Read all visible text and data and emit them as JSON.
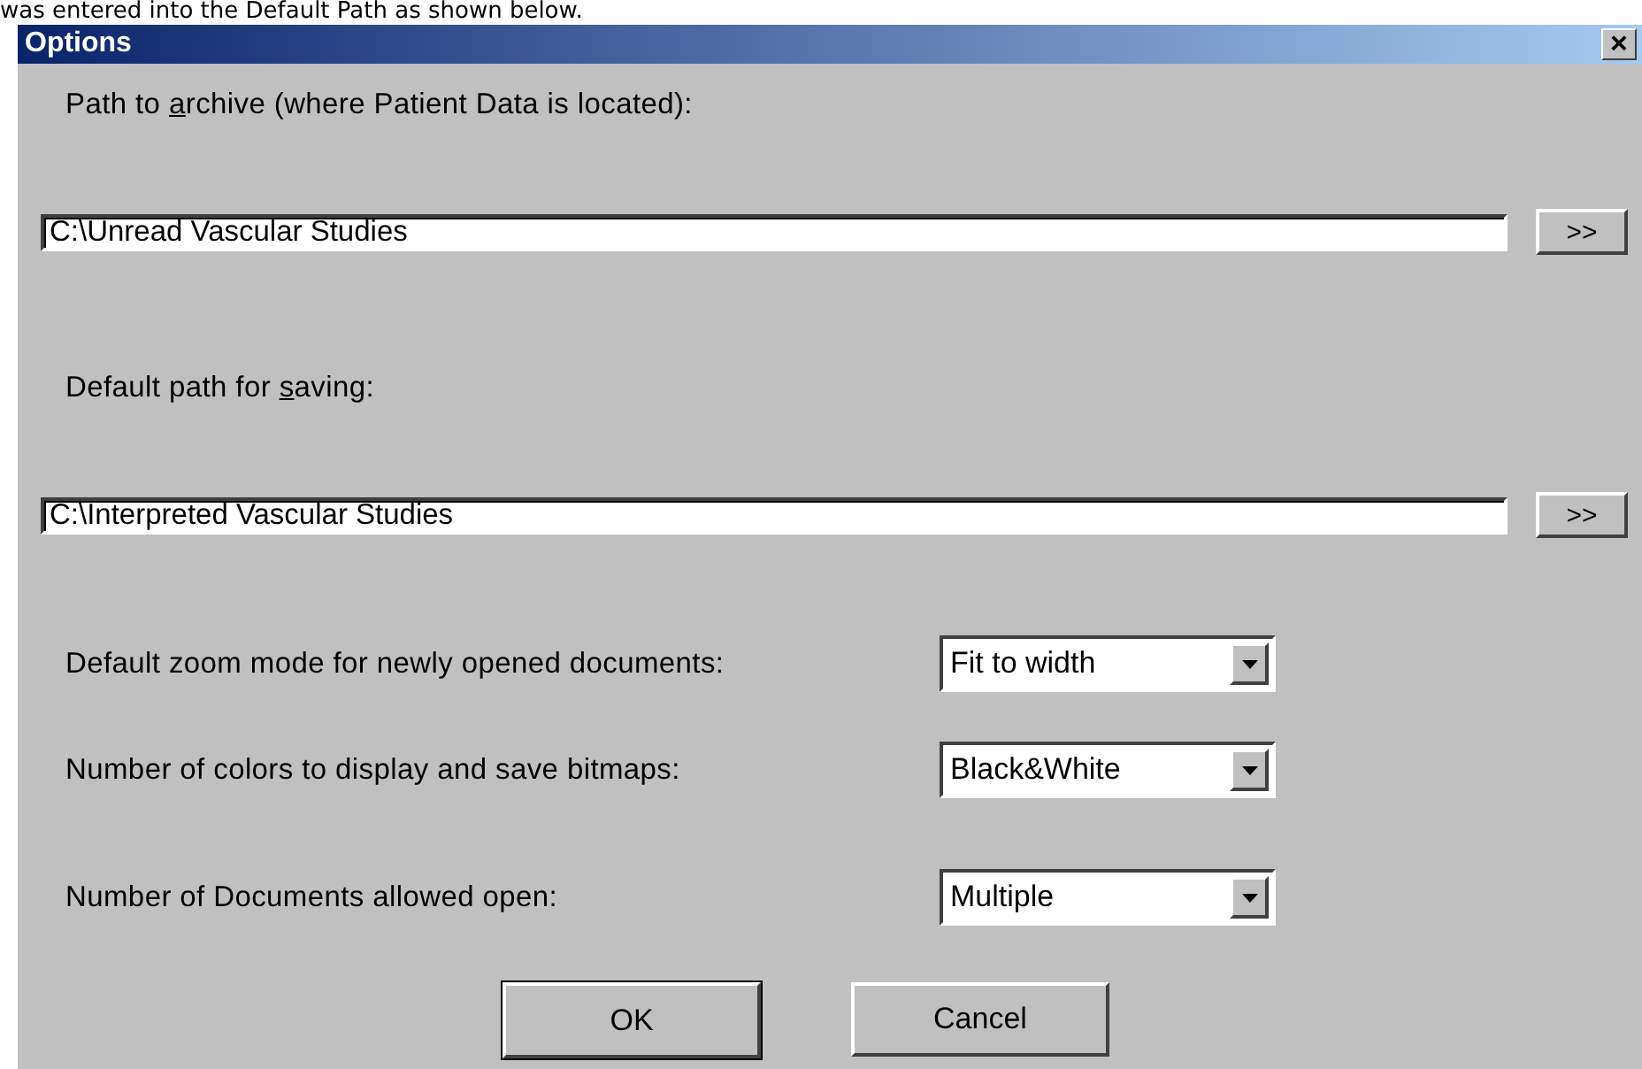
{
  "caption": "was entered into the Default Path as shown below.",
  "window": {
    "title": "Options",
    "close": "×"
  },
  "path_fields": [
    {
      "label_parts": [
        "Path to ",
        "a",
        "rchive (where Patient Data is located):"
      ],
      "value": "C:\\Unread Vascular Studies",
      "browse": ">>"
    },
    {
      "label_parts": [
        "Default path for ",
        "s",
        "aving:"
      ],
      "value": "C:\\Interpreted Vascular Studies",
      "browse": ">>"
    }
  ],
  "dropdowns": [
    {
      "label": "Default zoom mode for newly opened documents:",
      "value": "Fit to width"
    },
    {
      "label": "Number of colors to display and save bitmaps:",
      "value": "Black&White"
    },
    {
      "label": "Number of Documents allowed open:",
      "value": "Multiple"
    }
  ],
  "buttons": [
    {
      "label": "OK",
      "default": true
    },
    {
      "label": "Cancel",
      "default": false
    }
  ]
}
